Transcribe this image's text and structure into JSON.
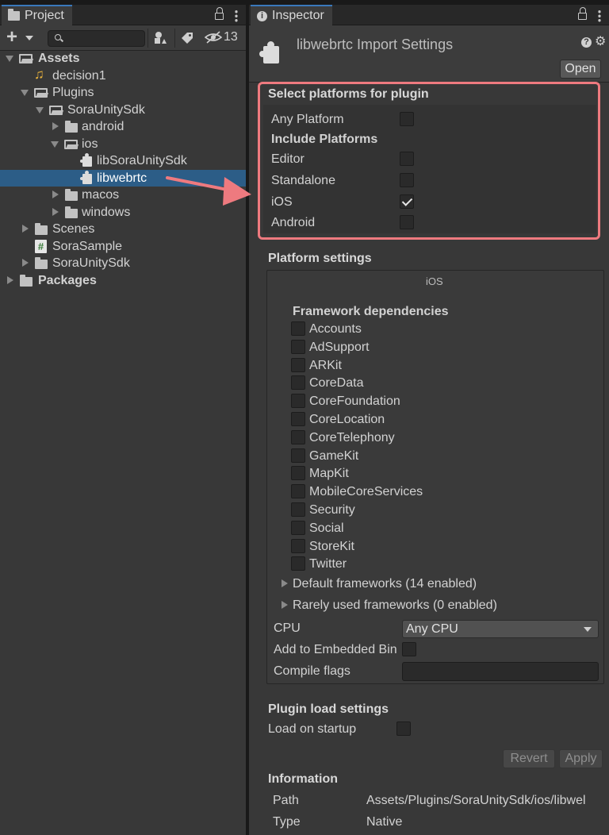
{
  "project": {
    "tab_label": "Project",
    "hidden_count": "13",
    "tree": [
      {
        "label": "Assets",
        "bold": true
      },
      {
        "label": "decision1"
      },
      {
        "label": "Plugins"
      },
      {
        "label": "SoraUnitySdk"
      },
      {
        "label": "android"
      },
      {
        "label": "ios"
      },
      {
        "label": "libSoraUnitySdk"
      },
      {
        "label": "libwebrtc",
        "selected": true
      },
      {
        "label": "macos"
      },
      {
        "label": "windows"
      },
      {
        "label": "Scenes"
      },
      {
        "label": "SoraSample"
      },
      {
        "label": "SoraUnitySdk"
      },
      {
        "label": "Packages",
        "bold": true
      }
    ]
  },
  "inspector": {
    "tab_label": "Inspector",
    "title": "libwebrtc Import Settings",
    "open_button": "Open",
    "select_platforms": {
      "title": "Select platforms for plugin",
      "any_platform": "Any Platform",
      "include_title": "Include Platforms",
      "platforms": [
        {
          "label": "Editor",
          "checked": false
        },
        {
          "label": "Standalone",
          "checked": false
        },
        {
          "label": "iOS",
          "checked": true
        },
        {
          "label": "Android",
          "checked": false
        }
      ]
    },
    "platform_settings": {
      "title": "Platform settings",
      "platform_name": "iOS",
      "framework_title": "Framework dependencies",
      "frameworks": [
        "Accounts",
        "AdSupport",
        "ARKit",
        "CoreData",
        "CoreFoundation",
        "CoreLocation",
        "CoreTelephony",
        "GameKit",
        "MapKit",
        "MobileCoreServices",
        "Security",
        "Social",
        "StoreKit",
        "Twitter"
      ],
      "default_frameworks": "Default frameworks (14 enabled)",
      "rarely_used": "Rarely used frameworks (0 enabled)",
      "cpu_label": "CPU",
      "cpu_value": "Any CPU",
      "embedded_label": "Add to Embedded Bin",
      "compile_flags_label": "Compile flags"
    },
    "plugin_load": {
      "title": "Plugin load settings",
      "load_on_startup": "Load on startup"
    },
    "revert_button": "Revert",
    "apply_button": "Apply",
    "information": {
      "title": "Information",
      "path_label": "Path",
      "path_value": "Assets/Plugins/SoraUnitySdk/ios/libwel",
      "type_label": "Type",
      "type_value": "Native"
    }
  },
  "colors": {
    "selection": "#2c5d87",
    "highlight": "#ee7a7f",
    "panel": "#383838"
  }
}
